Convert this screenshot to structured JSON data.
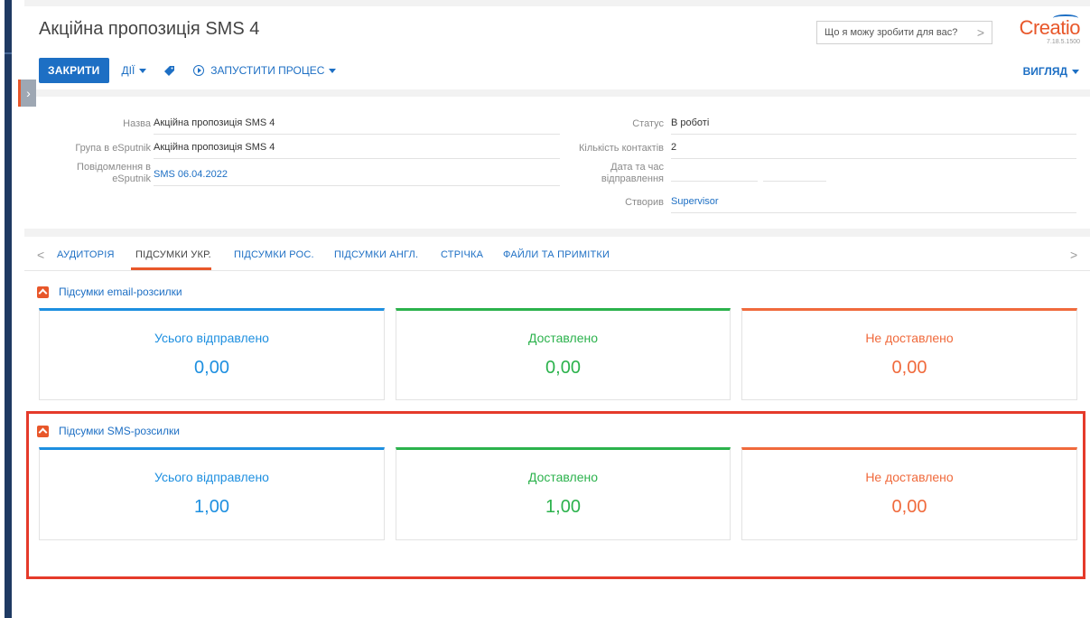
{
  "page": {
    "title": "Акційна пропозиція SMS 4"
  },
  "toolbar": {
    "close_label": "ЗАКРИТИ",
    "actions_label": "ДІЇ",
    "run_process_label": "ЗАПУСТИТИ ПРОЦЕС",
    "view_label": "ВИГЛЯД"
  },
  "search": {
    "placeholder": "Що я можу зробити для вас?"
  },
  "logo": {
    "name": "Creatio",
    "version": "7.18.5.1500"
  },
  "fields": {
    "name_label": "Назва",
    "name_value": "Акційна пропозиція SMS 4",
    "group_label": "Група в eSputnik",
    "group_value": "Акційна пропозиція SMS 4",
    "message_label_line1": "Повідомлення в",
    "message_label_line2": "eSputnik",
    "message_value": "SMS 06.04.2022",
    "status_label": "Статус",
    "status_value": "В роботі",
    "contacts_label": "Кількість контактів",
    "contacts_value": "2",
    "send_label_line1": "Дата та час",
    "send_label_line2": "відправлення",
    "created_label": "Створив",
    "created_value": "Supervisor"
  },
  "tabs": [
    {
      "label": "АУДИТОРІЯ"
    },
    {
      "label": "ПІДСУМКИ УКР.",
      "active": true
    },
    {
      "label": "ПІДСУМКИ РОС."
    },
    {
      "label": "ПІДСУМКИ АНГЛ."
    },
    {
      "label": "СТРІЧКА"
    },
    {
      "label": "ФАЙЛИ ТА ПРИМІТКИ"
    }
  ],
  "email_group": {
    "title": "Підсумки email-розсилки",
    "metrics": [
      {
        "title": "Усього відправлено",
        "value": "0,00",
        "color": "#1d8fe0"
      },
      {
        "title": "Доставлено",
        "value": "0,00",
        "color": "#2bb24c"
      },
      {
        "title": "Не доставлено",
        "value": "0,00",
        "color": "#f06a3c"
      }
    ]
  },
  "sms_group": {
    "title": "Підсумки SMS-розсилки",
    "metrics": [
      {
        "title": "Усього відправлено",
        "value": "1,00",
        "color": "#1d8fe0"
      },
      {
        "title": "Доставлено",
        "value": "1,00",
        "color": "#2bb24c"
      },
      {
        "title": "Не доставлено",
        "value": "0,00",
        "color": "#f06a3c"
      }
    ]
  },
  "colors": {
    "accent": "#1d6fc4",
    "brand": "#e8572a",
    "highlight": "#e53a2a"
  }
}
